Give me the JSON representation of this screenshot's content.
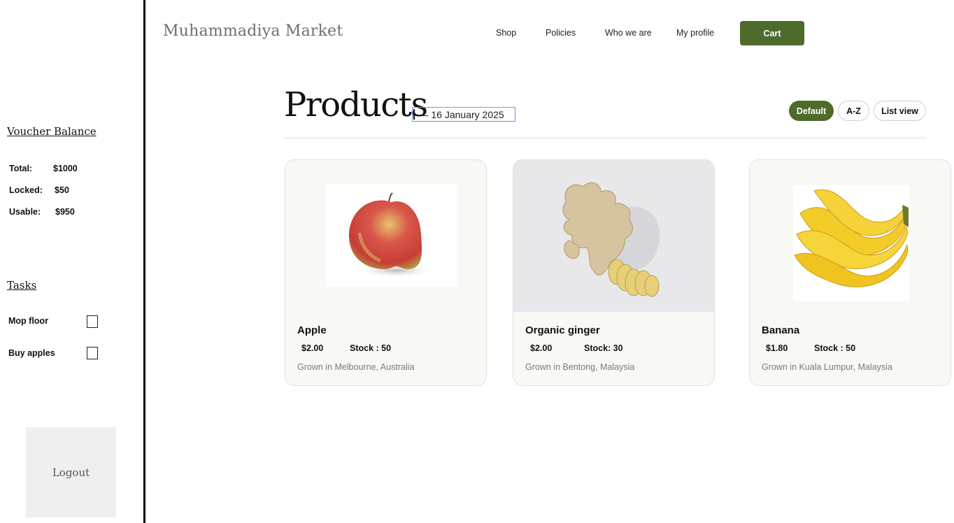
{
  "sidebar": {
    "voucher_heading": "Voucher Balance",
    "balance": [
      {
        "label": "Total:",
        "value": "$1000"
      },
      {
        "label": "Locked:",
        "value": "$50"
      },
      {
        "label": "Usable:",
        "value": "$950"
      }
    ],
    "tasks_heading": "Tasks",
    "tasks": [
      {
        "label": "Mop floor",
        "checked": false
      },
      {
        "label": "Buy apples",
        "checked": false
      }
    ],
    "logout_label": "Logout"
  },
  "header": {
    "brand": "Muhammadiya Market",
    "nav": [
      "Shop",
      "Policies",
      "Who we are",
      "My profile"
    ],
    "cart_label": "Cart"
  },
  "main": {
    "title": "Products",
    "date_text": "— 16 January 2025",
    "sort_options": [
      "Default",
      "A-Z",
      "List view"
    ],
    "selected_sort": "Default",
    "accent_color": "#4e6b2c",
    "products": [
      {
        "name": "Apple",
        "price": "$2.00",
        "stock": "Stock : 50",
        "origin": "Grown in Melbourne, Australia",
        "image": "apple-image"
      },
      {
        "name": "Organic ginger",
        "price": "$2.00",
        "stock": "Stock: 30",
        "origin": "Grown in Bentong, Malaysia",
        "image": "ginger-image"
      },
      {
        "name": "Banana",
        "price": "$1.80",
        "stock": "Stock : 50",
        "origin": "Grown in Kuala Lumpur, Malaysia",
        "image": "banana-image"
      }
    ]
  }
}
